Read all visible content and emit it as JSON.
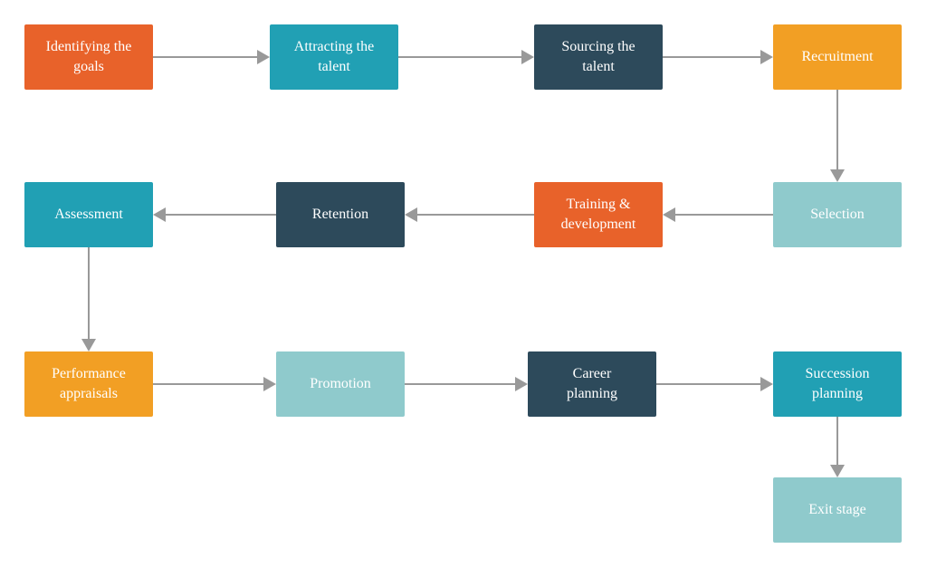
{
  "colors": {
    "orange": "#E8622A",
    "teal": "#21A0B4",
    "navy": "#2D4A5B",
    "amber": "#F29F24",
    "light_teal": "#8FCACC",
    "arrow": "#999999"
  },
  "nodes": [
    {
      "id": "identifying-goals",
      "label": "Identifying the\ngoals",
      "color": "#E8622A"
    },
    {
      "id": "attracting-talent",
      "label": "Attracting the\ntalent",
      "color": "#21A0B4"
    },
    {
      "id": "sourcing-talent",
      "label": "Sourcing the\ntalent",
      "color": "#2D4A5B"
    },
    {
      "id": "recruitment",
      "label": "Recruitment",
      "color": "#F29F24"
    },
    {
      "id": "selection",
      "label": "Selection",
      "color": "#8FCACC"
    },
    {
      "id": "training-development",
      "label": "Training &\ndevelopment",
      "color": "#E8622A"
    },
    {
      "id": "retention",
      "label": "Retention",
      "color": "#2D4A5B"
    },
    {
      "id": "assessment",
      "label": "Assessment",
      "color": "#21A0B4"
    },
    {
      "id": "performance-appraisals",
      "label": "Performance\nappraisals",
      "color": "#F29F24"
    },
    {
      "id": "promotion",
      "label": "Promotion",
      "color": "#8FCACC"
    },
    {
      "id": "career-planning",
      "label": "Career\nplanning",
      "color": "#2D4A5B"
    },
    {
      "id": "succession-planning",
      "label": "Succession\nplanning",
      "color": "#21A0B4"
    },
    {
      "id": "exit-stage",
      "label": "Exit stage",
      "color": "#8FCACC"
    }
  ],
  "edges": [
    [
      "identifying-goals",
      "attracting-talent"
    ],
    [
      "attracting-talent",
      "sourcing-talent"
    ],
    [
      "sourcing-talent",
      "recruitment"
    ],
    [
      "recruitment",
      "selection"
    ],
    [
      "selection",
      "training-development"
    ],
    [
      "training-development",
      "retention"
    ],
    [
      "retention",
      "assessment"
    ],
    [
      "assessment",
      "performance-appraisals"
    ],
    [
      "performance-appraisals",
      "promotion"
    ],
    [
      "promotion",
      "career-planning"
    ],
    [
      "career-planning",
      "succession-planning"
    ],
    [
      "succession-planning",
      "exit-stage"
    ]
  ]
}
